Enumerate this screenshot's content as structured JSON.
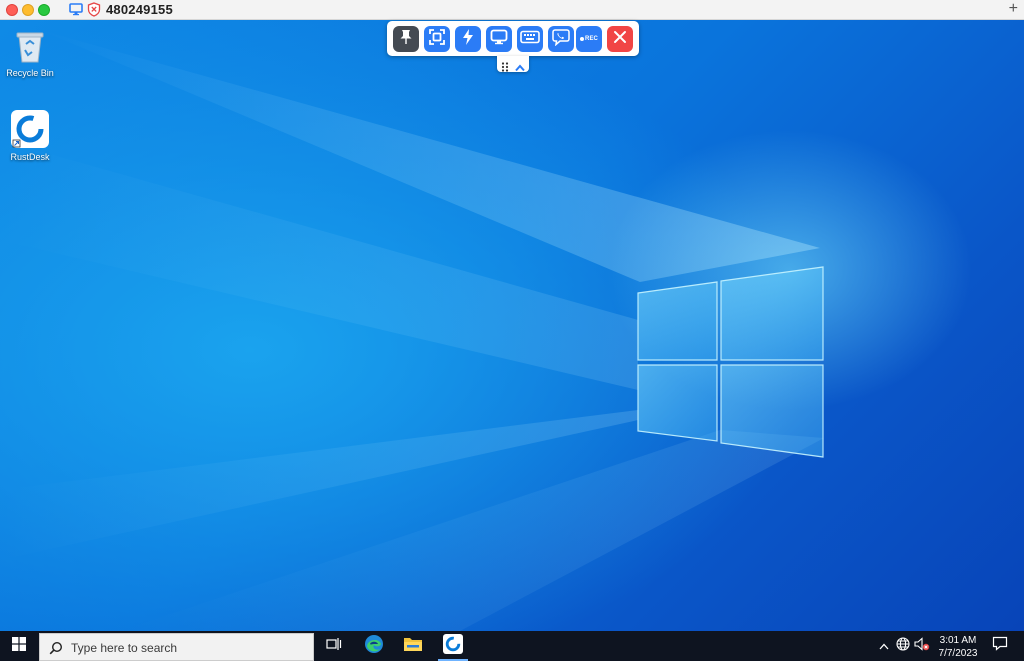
{
  "window": {
    "title": "480249155",
    "icons": [
      "monitor-icon",
      "shield-x-icon",
      "plus-icon"
    ]
  },
  "desktop": {
    "icons": [
      {
        "label": "Recycle Bin",
        "icon": "recycle-bin-icon"
      },
      {
        "label": "RustDesk",
        "icon": "rustdesk-icon"
      }
    ]
  },
  "remote_toolbar": {
    "buttons": [
      "pin-icon",
      "fullscreen-icon",
      "lightning-icon",
      "display-icon",
      "keyboard-icon",
      "chat-icon",
      "record-icon",
      "close-icon"
    ],
    "rec_label": "REC",
    "colors": {
      "button": "#2b7cf6",
      "pin": "#444a52",
      "close": "#f14545"
    }
  },
  "taskbar": {
    "search_placeholder": "Type here to search",
    "pinned_apps": [
      "task-view-icon",
      "edge-icon",
      "file-explorer-icon",
      "rustdesk-icon"
    ],
    "tray_icons": [
      "chevron-up-icon",
      "network-icon",
      "volume-muted-icon",
      "notification-icon"
    ],
    "time": "3:01 AM",
    "date": "7/7/2023"
  }
}
